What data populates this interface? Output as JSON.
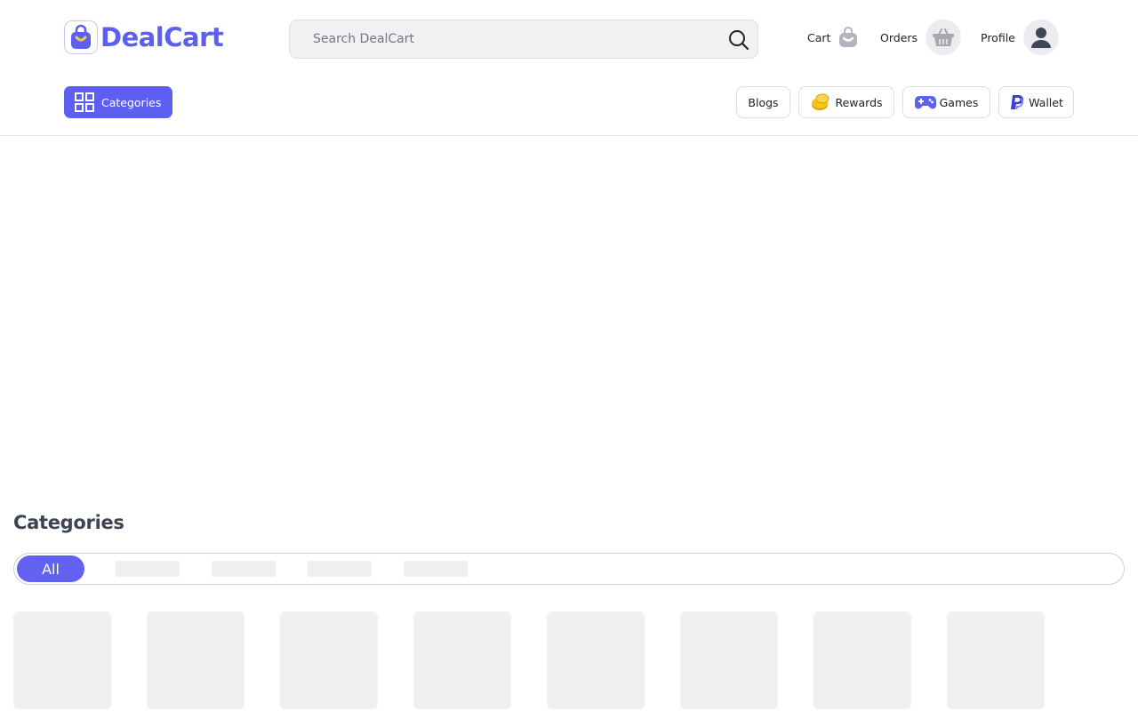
{
  "brand": {
    "name": "DealCart",
    "logo_icon": "shopping-bag-smile-icon",
    "accent": "#5d5ff0"
  },
  "search": {
    "placeholder": "Search DealCart",
    "value": "",
    "icon": "search-icon"
  },
  "top_nav": {
    "cart_label": "Cart",
    "orders_label": "Orders",
    "profile_label": "Profile"
  },
  "categories_button": {
    "label": "Categories",
    "icon": "grid-icon"
  },
  "quick_links": {
    "blogs": "Blogs",
    "rewards": "Rewards",
    "games": "Games",
    "wallet": "Wallet"
  },
  "categories_section": {
    "title": "Categories",
    "active_tab": "All",
    "tab_placeholders": 4,
    "card_placeholders": 8
  }
}
